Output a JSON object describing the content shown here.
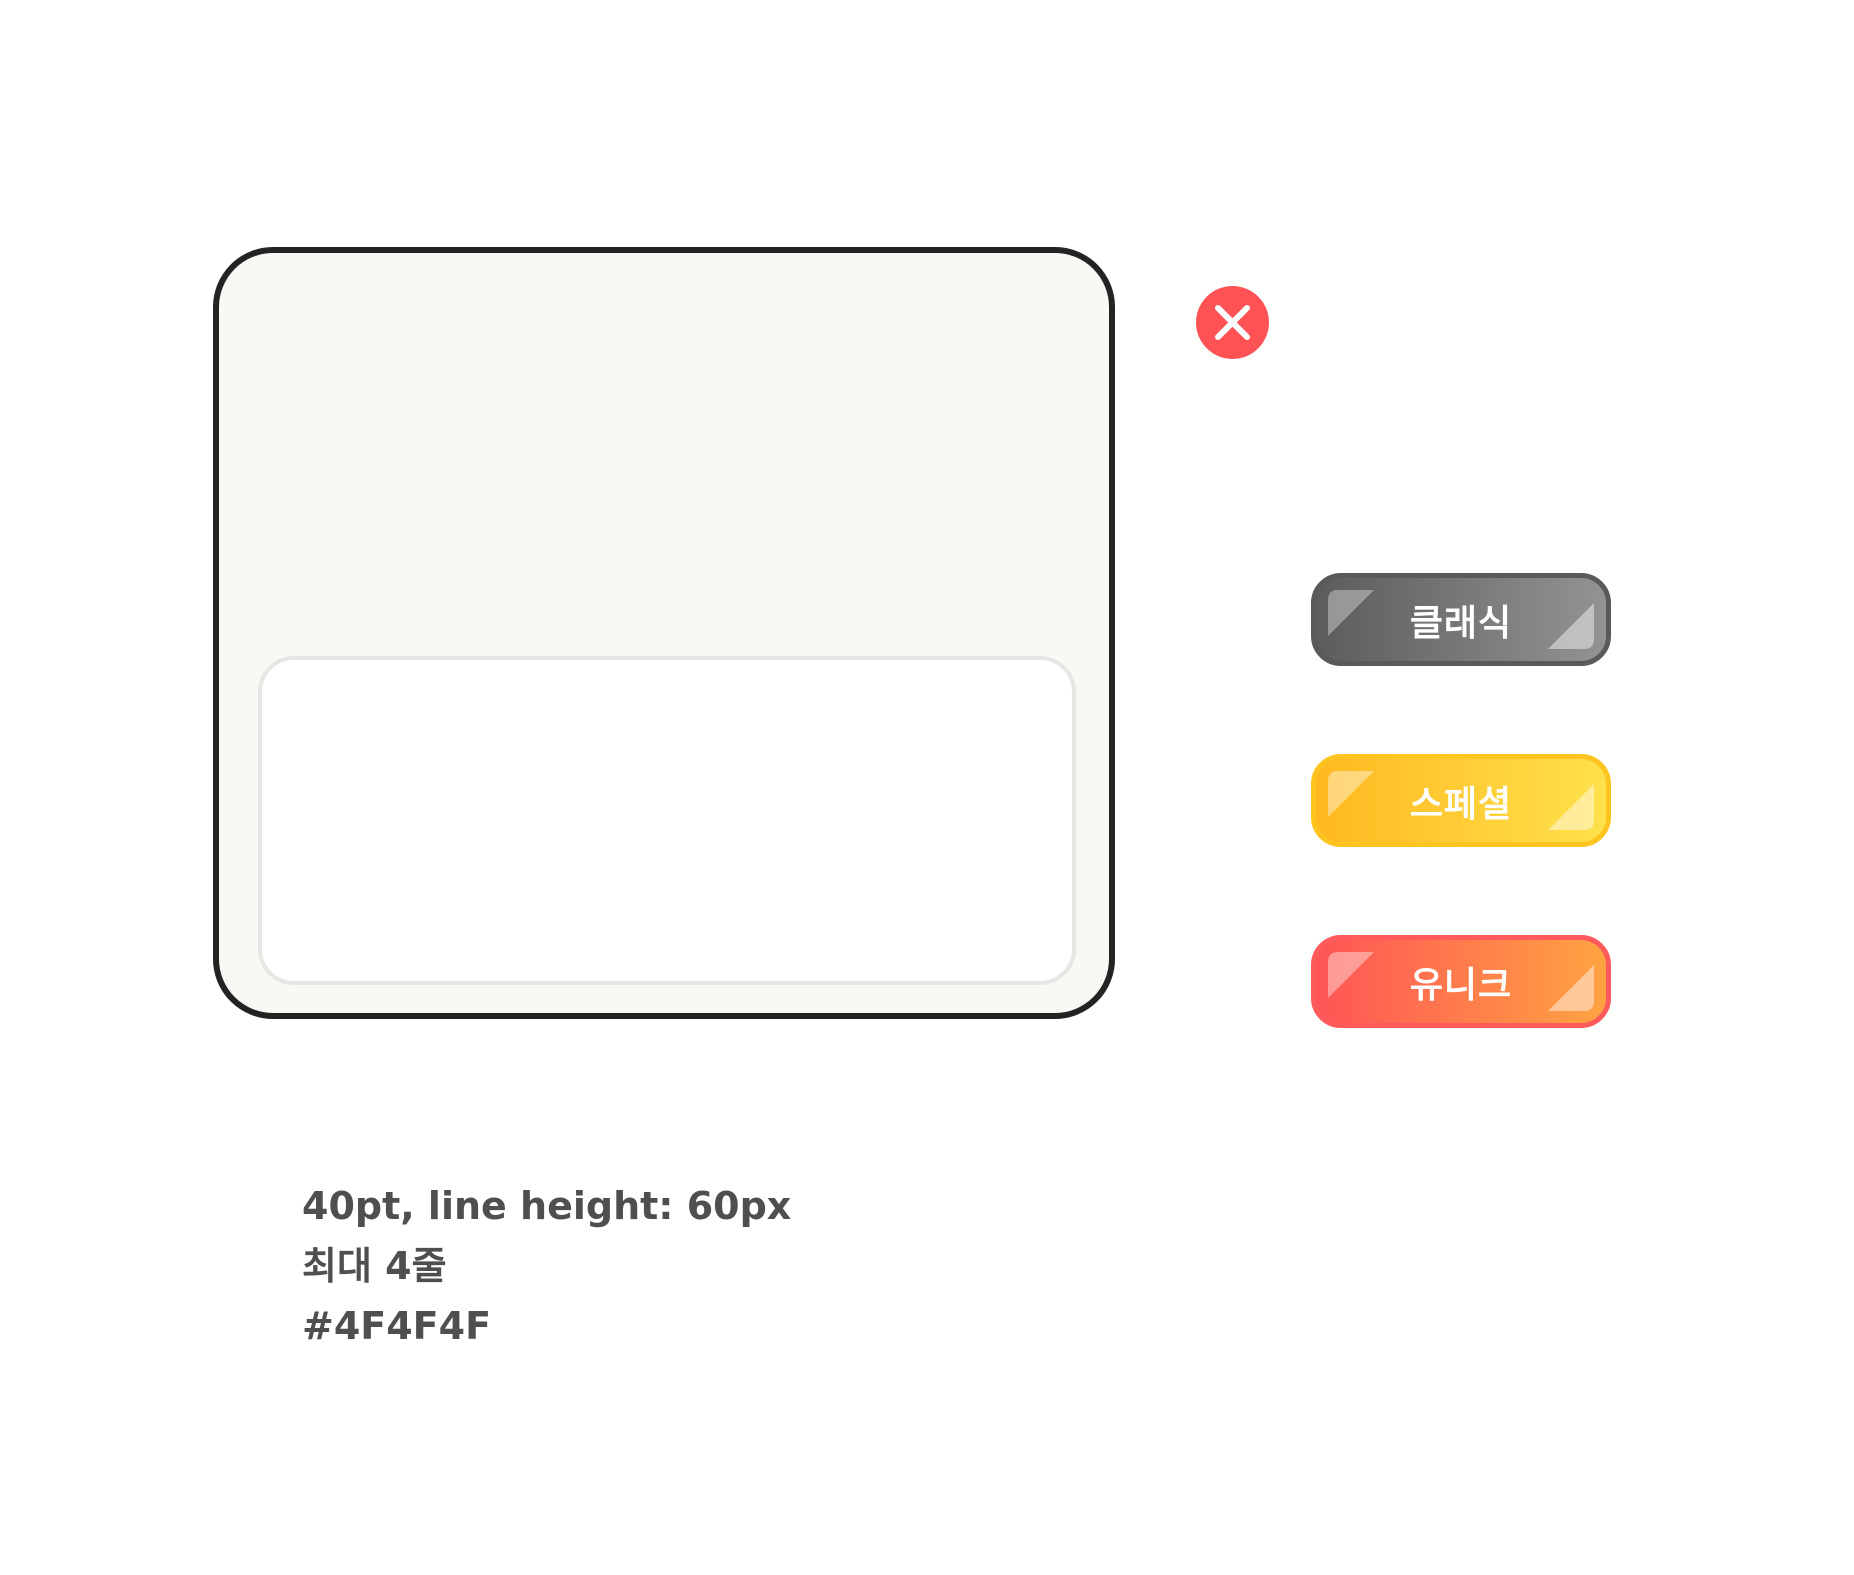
{
  "dialog": {
    "card_bg": "#f9f8f4",
    "card_border": "#232323",
    "text_box_bg": "#ffffff",
    "text_box_border": "#e6e6e4"
  },
  "close_button": {
    "icon": "close-icon",
    "color": "#fe5255"
  },
  "grade_buttons": [
    {
      "label": "클래식",
      "colors": [
        "#5c5c5c",
        "#939393"
      ]
    },
    {
      "label": "스페셜",
      "colors": [
        "#ffb820",
        "#ffe14c"
      ]
    },
    {
      "label": "유니크",
      "colors": [
        "#ff5456",
        "#ffa342"
      ]
    }
  ],
  "spec": {
    "line1": "40pt, line height: 60px",
    "line2": "최대 4줄",
    "line3": "#4F4F4F",
    "text_color": "#4f4f4f"
  }
}
